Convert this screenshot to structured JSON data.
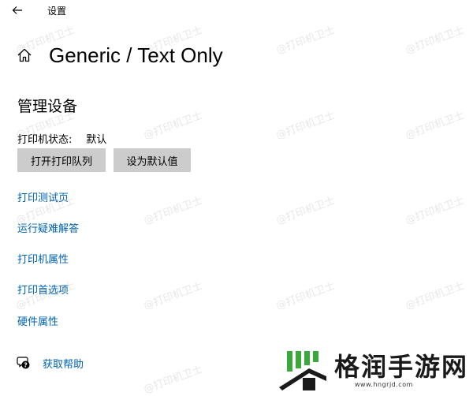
{
  "app": {
    "title": "设置"
  },
  "header": {
    "title": "Generic / Text Only"
  },
  "section": {
    "title": "管理设备"
  },
  "printer_status": {
    "label": "打印机状态:",
    "value": "默认"
  },
  "buttons": {
    "open_queue": "打开打印队列",
    "set_default": "设为默认值"
  },
  "links": [
    "打印测试页",
    "运行疑难解答",
    "打印机属性",
    "打印首选项",
    "硬件属性"
  ],
  "help": {
    "label": "获取帮助"
  },
  "watermark": {
    "text": "@打印机卫士"
  },
  "logo": {
    "name": "格润手游网",
    "url": "www.hngrjd.com"
  },
  "icons": {
    "back": "back-arrow-icon",
    "home": "home-icon",
    "help": "help-chat-icon"
  },
  "colors": {
    "link": "#0063b1",
    "button_bg": "#cccccc",
    "background": "#ffffff",
    "logo_green": "#3aa83a"
  }
}
